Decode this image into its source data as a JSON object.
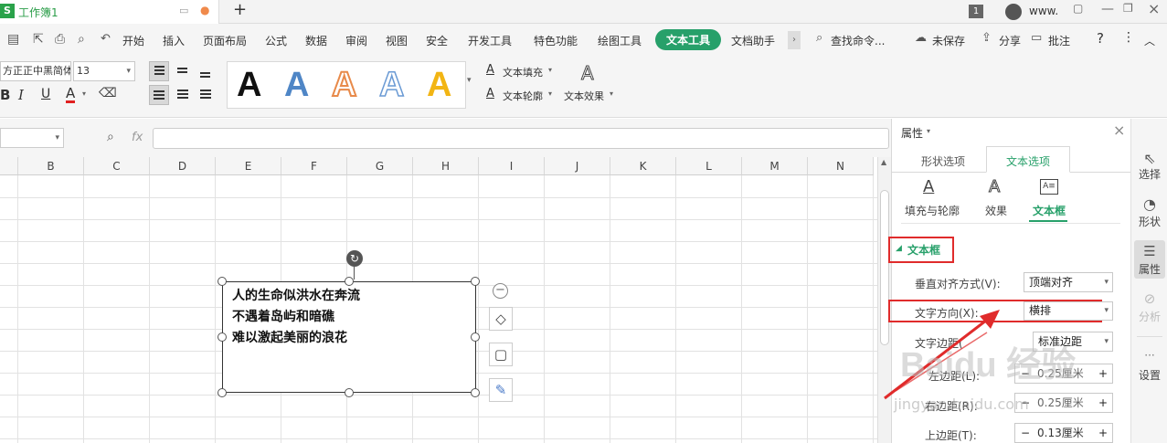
{
  "tabbar": {
    "doc_title": "工作簿1",
    "new_tab": "+",
    "page_num": "1",
    "user": "www."
  },
  "menubar": {
    "items": [
      "开始",
      "插入",
      "页面布局",
      "公式",
      "数据",
      "审阅",
      "视图",
      "安全",
      "开发工具",
      "特色功能",
      "绘图工具",
      "文本工具",
      "文档助手"
    ],
    "active": "文本工具",
    "search": "查找命令...",
    "unsaved": "未保存",
    "share": "分享",
    "annotate": "批注",
    "help": "?"
  },
  "ribbon": {
    "font_name": "方正正中黑简体",
    "font_size": "13",
    "bold": "B",
    "italic": "I",
    "underline": "U",
    "font_color": "A",
    "style_letter": "A",
    "text_fill": "文本填充",
    "text_outline": "文本轮廓",
    "text_effect": "文本效果"
  },
  "formula": {
    "fx": "fx"
  },
  "sheet": {
    "columns": [
      "B",
      "C",
      "D",
      "E",
      "F",
      "G",
      "H",
      "I",
      "J",
      "K",
      "L",
      "M",
      "N"
    ]
  },
  "textbox": {
    "lines": [
      "人的生命似洪水在奔流",
      "不遇着岛屿和暗礁",
      "难以激起美丽的浪花"
    ],
    "minus": "−"
  },
  "panel": {
    "title": "属性",
    "tabs": [
      "形状选项",
      "文本选项"
    ],
    "active_tab": "文本选项",
    "subtabs": [
      "填充与轮廓",
      "效果",
      "文本框"
    ],
    "active_subtab": "文本框",
    "section": "文本框",
    "rows": [
      {
        "label": "垂直对齐方式(V):",
        "value": "顶端对齐"
      },
      {
        "label": "文字方向(X):",
        "value": "横排"
      },
      {
        "label": "文字边距(",
        "value": "标准边距"
      },
      {
        "label": "左边距(L):",
        "value": "0.25厘米"
      },
      {
        "label": "右边距(R):",
        "value": "0.25厘米"
      },
      {
        "label": "上边距(T):",
        "value": "0.13厘米"
      }
    ]
  },
  "sidebar": {
    "items": [
      "选择",
      "形状",
      "属性",
      "分析",
      "设置"
    ]
  },
  "watermark": {
    "text": "Baidu 经验",
    "url": "jingyan.baidu.com"
  },
  "colors": {
    "accent": "#27a06a",
    "highlight": "#e02b2b",
    "title_green": "#2a9d48"
  }
}
